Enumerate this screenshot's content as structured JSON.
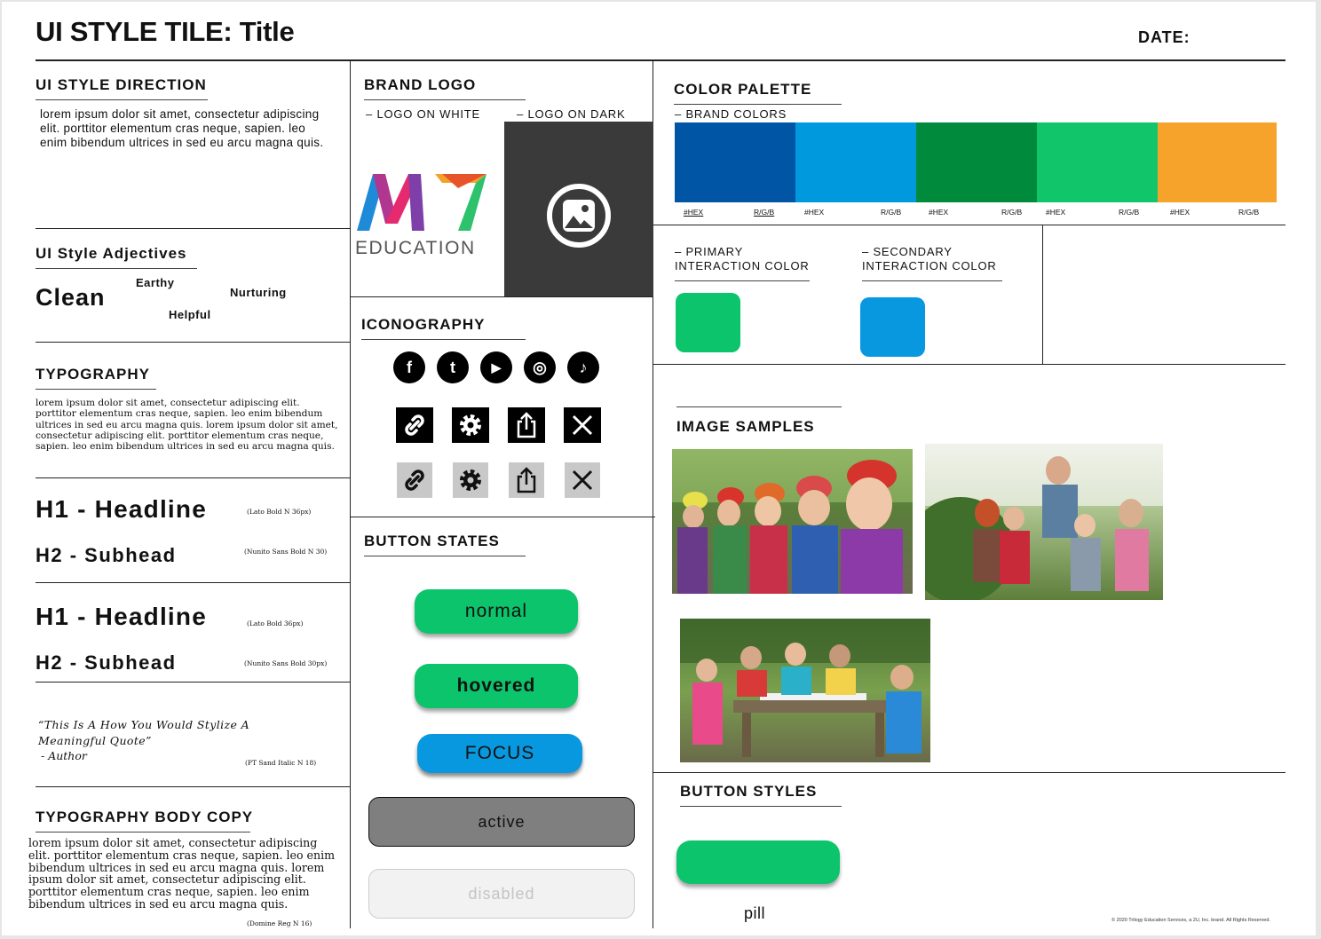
{
  "header": {
    "title": "UI STYLE TILE: Title",
    "date_label": "DATE:"
  },
  "style_direction": {
    "heading": "UI STYLE DIRECTION",
    "body": "lorem ipsum dolor sit amet, consectetur adipiscing elit. porttitor elementum cras neque, sapien. leo enim bibendum ultrices in sed eu arcu magna quis."
  },
  "adjectives": {
    "heading": "UI Style Adjectives",
    "main": "Clean",
    "words": [
      "Earthy",
      "Nurturing",
      "Helpful"
    ]
  },
  "typography": {
    "heading": "TYPOGRAPHY",
    "body": "lorem ipsum dolor sit amet, consectetur adipiscing elit. porttitor elementum cras neque, sapien. leo enim bibendum ultrices in sed eu arcu magna quis. lorem ipsum dolor sit amet, consectetur adipiscing elit. porttitor elementum cras neque, sapien. leo enim bibendum ultrices in sed eu arcu magna quis.",
    "set1": {
      "h1": "H1 - Headline",
      "h1_note": "(Lato Bold N 36px)",
      "h2": "H2 - Subhead",
      "h2_note": "(Nunito Sans  Bold N 30)"
    },
    "set2": {
      "h1": "H1 - Headline",
      "h1_note": "(Lato Bold 36px)",
      "h2": "H2 - Subhead",
      "h2_note": "(Nunito Sans Bold 30px)"
    },
    "quote": "“This Is A How You Would Stylize A Meaningful Quote”",
    "quote_author": "- Author",
    "quote_note": "(PT Sand Italic N 18)",
    "body_copy_heading": "TYPOGRAPHY BODY COPY",
    "body_copy": "lorem ipsum dolor sit amet, consectetur adipiscing elit. porttitor elementum cras neque, sapien. leo enim bibendum ultrices in sed eu arcu magna quis. lorem ipsum dolor sit amet, consectetur adipiscing elit. porttitor elementum cras neque, sapien. leo enim bibendum ultrices in sed eu arcu magna quis.",
    "body_copy_note": "(Domine  Reg N 16)"
  },
  "brand_logo": {
    "heading": "BRAND LOGO",
    "on_white": "– LOGO ON WHITE",
    "on_dark": "– LOGO ON DARK",
    "logo_text": "EDUCATION",
    "logo_mark": "M7"
  },
  "iconography": {
    "heading": "ICONOGRAPHY",
    "social": [
      "facebook-icon",
      "twitter-icon",
      "youtube-icon",
      "instagram-icon",
      "tiktok-icon"
    ],
    "social_glyphs": [
      "f",
      "t",
      "▶",
      "◎",
      "♪"
    ],
    "tools": [
      "link-icon",
      "gear-icon",
      "share-icon",
      "close-icon"
    ]
  },
  "button_states": {
    "heading": "BUTTON STATES",
    "normal": "normal",
    "hovered": "hovered",
    "focus": "FOCUS",
    "active": "active",
    "disabled": "disabled"
  },
  "color_palette": {
    "heading": "COLOR PALETTE",
    "brand_label": "– BRAND COLORS",
    "colors": [
      {
        "hex": "#0055a5",
        "hex_label": "#HEX",
        "rgb_label": "R/G/B"
      },
      {
        "hex": "#0099dd",
        "hex_label": "#HEX",
        "rgb_label": "R/G/B"
      },
      {
        "hex": "#008a3c",
        "hex_label": "#HEX",
        "rgb_label": "R/G/B"
      },
      {
        "hex": "#11c56a",
        "hex_label": "#HEX",
        "rgb_label": "R/G/B"
      },
      {
        "hex": "#f6a32c",
        "hex_label": "#HEX",
        "rgb_label": "R/G/B"
      }
    ],
    "primary_label": "– PRIMARY INTERACTION COLOR",
    "primary_color": "#0cc46b",
    "secondary_label": "– SECONDARY INTERACTION COLOR",
    "secondary_color": "#0898e0"
  },
  "image_samples": {
    "heading": "IMAGE SAMPLES"
  },
  "button_styles": {
    "heading": "BUTTON STYLES",
    "pill_label": "pill"
  },
  "footer": "© 2020 Trilogy Education Services, a 2U, Inc. brand. All Rights Reserved."
}
